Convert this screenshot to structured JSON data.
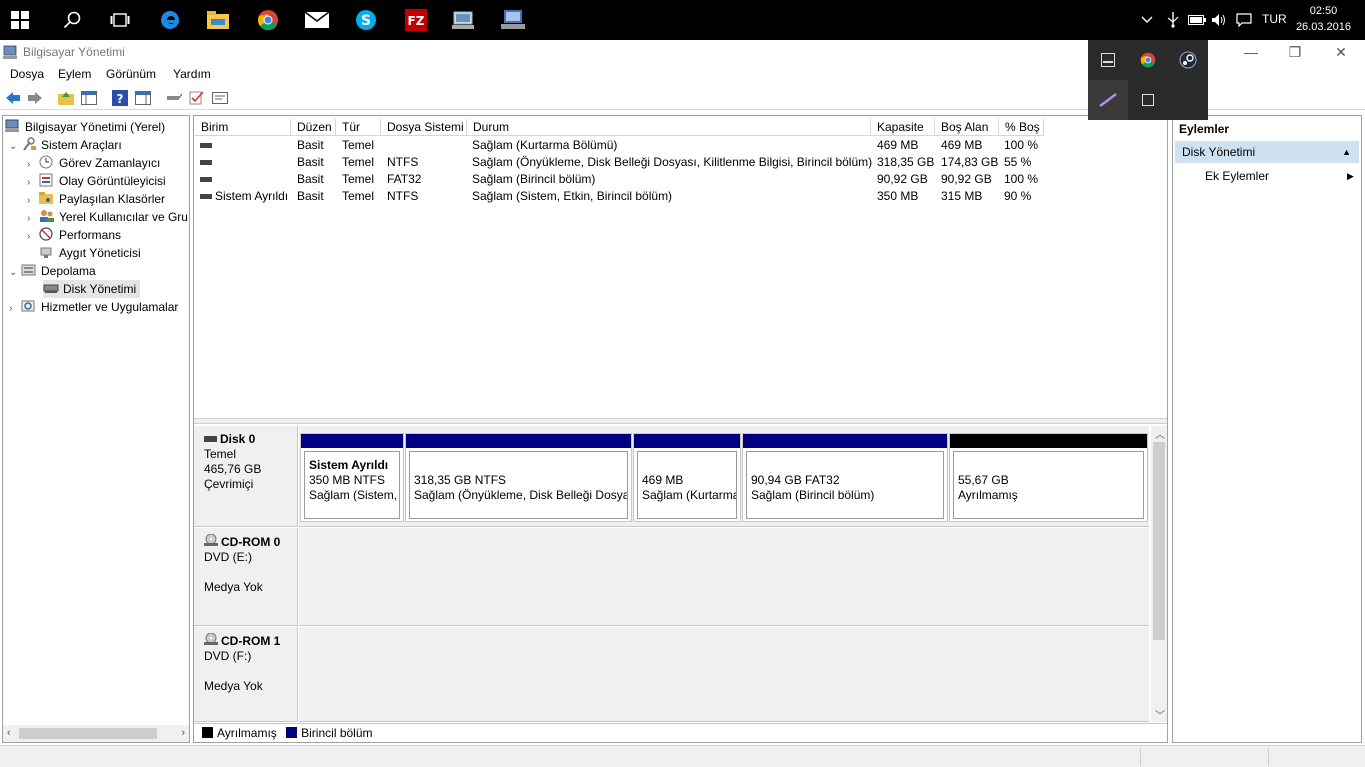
{
  "taskbar": {
    "lang": "TUR",
    "time": "02:50",
    "date": "26.03.2016"
  },
  "window": {
    "title": "Bilgisayar Yönetimi",
    "minimize": "—",
    "restore": "❐",
    "close": "✕"
  },
  "menu": [
    "Dosya",
    "Eylem",
    "Görünüm",
    "Yardım"
  ],
  "tree": [
    {
      "label": "Bilgisayar Yönetimi (Yerel)"
    },
    {
      "label": "Sistem Araçları"
    },
    {
      "label": "Görev Zamanlayıcı"
    },
    {
      "label": "Olay Görüntüleyicisi"
    },
    {
      "label": "Paylaşılan Klasörler"
    },
    {
      "label": "Yerel Kullanıcılar ve Gru"
    },
    {
      "label": "Performans"
    },
    {
      "label": "Aygıt Yöneticisi"
    },
    {
      "label": "Depolama"
    },
    {
      "label": "Disk Yönetimi"
    },
    {
      "label": "Hizmetler ve Uygulamalar"
    }
  ],
  "table": {
    "headers": [
      "Birim",
      "Düzen",
      "Tür",
      "Dosya Sistemi",
      "Durum",
      "Kapasite",
      "Boş Alan",
      "% Boş"
    ],
    "rows": [
      [
        "",
        "Basit",
        "Temel",
        "",
        "Sağlam (Kurtarma Bölümü)",
        "469 MB",
        "469 MB",
        "100 %"
      ],
      [
        "",
        "Basit",
        "Temel",
        "NTFS",
        "Sağlam (Önyükleme, Disk Belleği Dosyası, Kilitlenme Bilgisi, Birincil bölüm)",
        "318,35 GB",
        "174,83 GB",
        "55 %"
      ],
      [
        "",
        "Basit",
        "Temel",
        "FAT32",
        "Sağlam (Birincil bölüm)",
        "90,92 GB",
        "90,92 GB",
        "100 %"
      ],
      [
        "Sistem Ayrıldı",
        "Basit",
        "Temel",
        "NTFS",
        "Sağlam (Sistem, Etkin, Birincil bölüm)",
        "350 MB",
        "315 MB",
        "90 %"
      ]
    ]
  },
  "disks": {
    "disk0": {
      "name": "Disk 0",
      "type": "Temel",
      "size": "465,76 GB",
      "status": "Çevrimiçi"
    },
    "parts": [
      {
        "title": "Sistem Ayrıldı",
        "line1": "350 MB NTFS",
        "line2": "Sağlam (Sistem, E"
      },
      {
        "title": "",
        "line1": "318,35 GB NTFS",
        "line2": "Sağlam (Önyükleme, Disk Belleği Dosyas"
      },
      {
        "title": "",
        "line1": "469 MB",
        "line2": "Sağlam (Kurtarma"
      },
      {
        "title": "",
        "line1": "90,94 GB FAT32",
        "line2": "Sağlam (Birincil bölüm)"
      },
      {
        "title": "",
        "line1": "55,67 GB",
        "line2": "Ayrılmamış"
      }
    ],
    "cd0": {
      "name": "CD-ROM 0",
      "drive": "DVD (E:)",
      "status": "Medya Yok"
    },
    "cd1": {
      "name": "CD-ROM 1",
      "drive": "DVD (F:)",
      "status": "Medya Yok"
    }
  },
  "legend": {
    "unallocated": "Ayrılmamış",
    "primary": "Birincil bölüm"
  },
  "actions": {
    "header": "Eylemler",
    "selected": "Disk Yönetimi",
    "more": "Ek Eylemler"
  },
  "colors": {
    "primary_partition": "#000080",
    "unallocated": "#000000",
    "selection": "#cde1f1"
  }
}
